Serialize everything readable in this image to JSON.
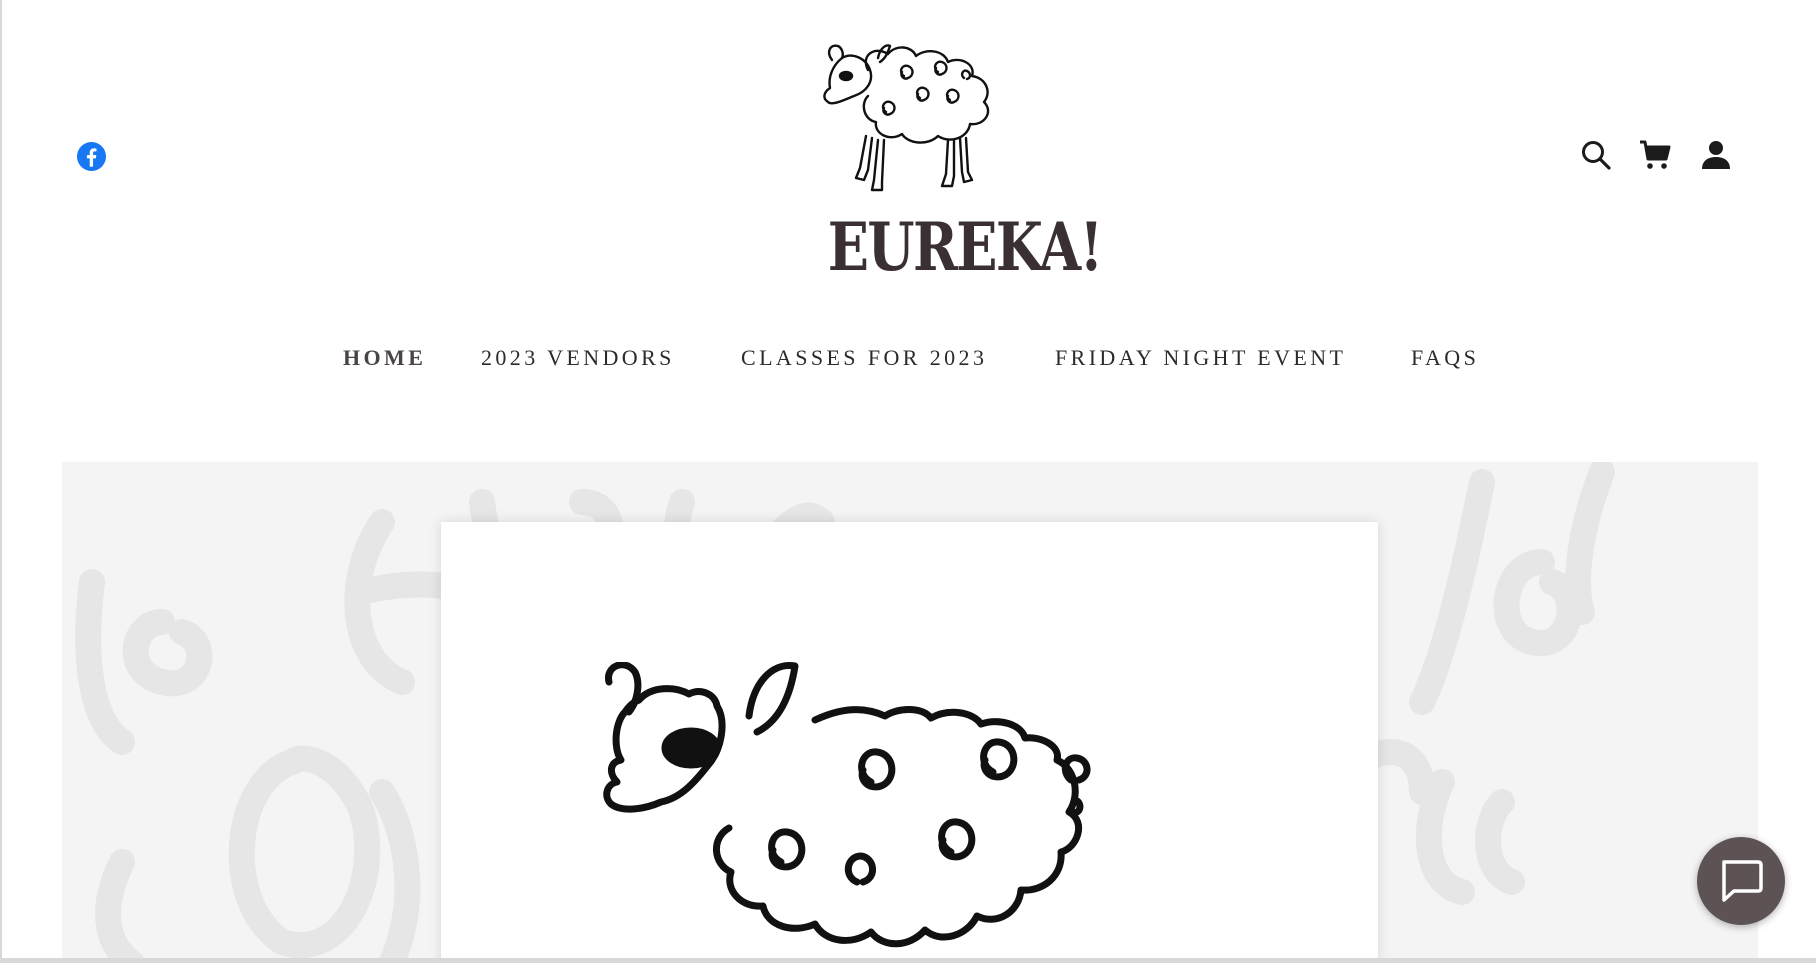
{
  "brand": {
    "name": "EUREKA!",
    "logo_alt": "Eureka sheep logo"
  },
  "header": {
    "social": [
      {
        "network": "facebook",
        "icon": "facebook-icon",
        "color": "#1877f2"
      }
    ],
    "tools": [
      {
        "name": "search",
        "icon": "search-icon"
      },
      {
        "name": "cart",
        "icon": "cart-icon"
      },
      {
        "name": "account",
        "icon": "account-icon"
      }
    ]
  },
  "nav": {
    "items": [
      {
        "label": "HOME",
        "active": true
      },
      {
        "label": "2023 VENDORS",
        "active": false
      },
      {
        "label": "CLASSES FOR 2023",
        "active": false
      },
      {
        "label": "FRIDAY NIGHT EVENT",
        "active": false
      },
      {
        "label": "FAQS",
        "active": false
      }
    ]
  },
  "hero": {
    "image_alt": "Sheep illustration",
    "background_color": "#f4f4f4"
  },
  "chat": {
    "icon": "chat-bubble-icon",
    "color": "#5d5355"
  }
}
